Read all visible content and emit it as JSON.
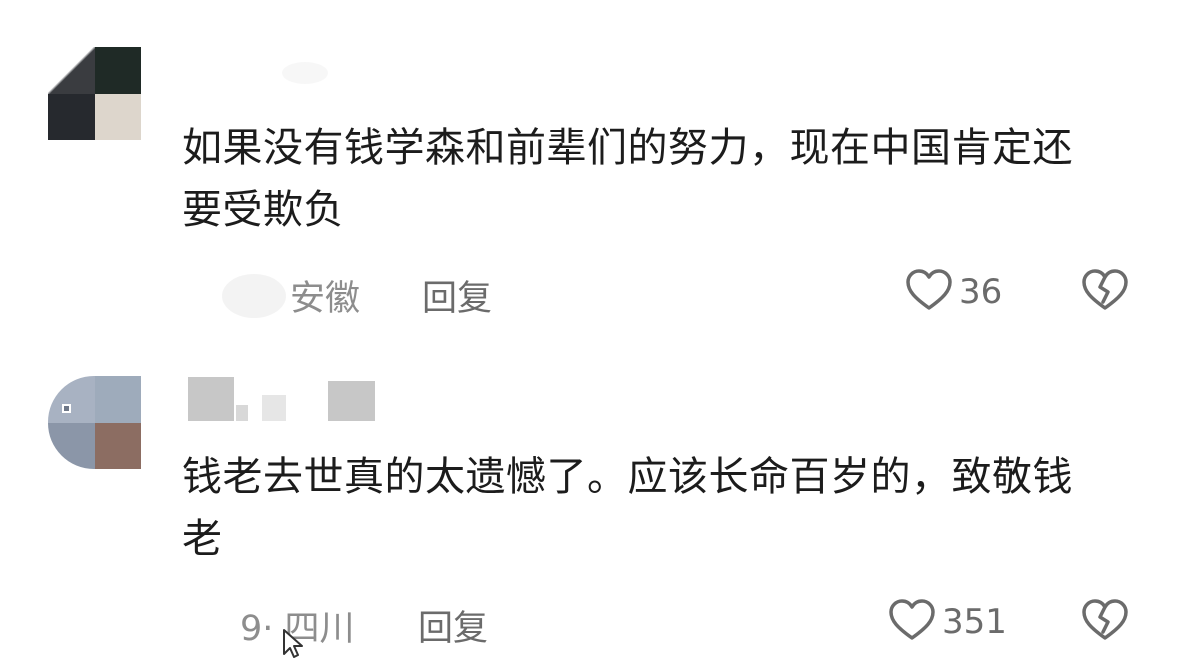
{
  "comments": [
    {
      "text": "如果没有钱学森和前辈们的努力，现在中国肯定还要受欺负",
      "location": "安徽",
      "reply_label": "回复",
      "likes": "36"
    },
    {
      "text": "钱老去世真的太遗憾了。应该长命百岁的，致敬钱老",
      "date_location": "9· 四川",
      "reply_label": "回复",
      "likes": "351"
    }
  ],
  "icons": {
    "like": "heart-outline-icon",
    "dislike": "broken-heart-icon"
  }
}
